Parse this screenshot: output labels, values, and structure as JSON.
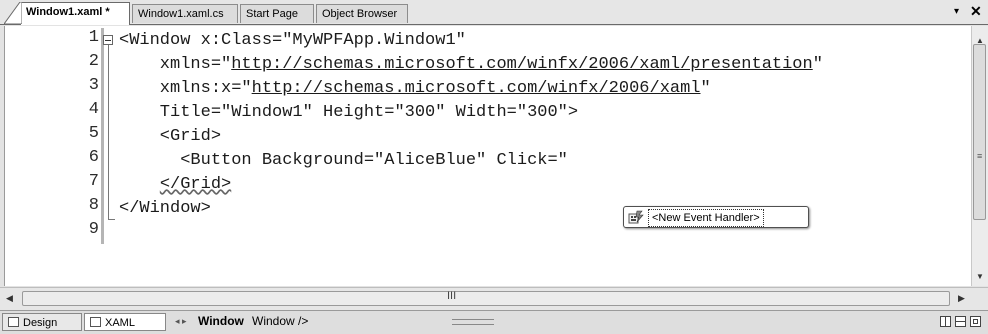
{
  "tabs": [
    {
      "label": "Window1.xaml *",
      "active": true
    },
    {
      "label": "Window1.xaml.cs",
      "active": false
    },
    {
      "label": "Start Page",
      "active": false
    },
    {
      "label": "Object Browser",
      "active": false
    }
  ],
  "tab_controls": {
    "dropdown": "▾",
    "close": "✕"
  },
  "editor": {
    "line_numbers": [
      "1",
      "2",
      "3",
      "4",
      "5",
      "6",
      "7",
      "8",
      "9"
    ],
    "lines": [
      {
        "pre": "<Window x:Class=\"MyWPFApp.Window1\"",
        "url": "",
        "post": ""
      },
      {
        "pre": "    xmlns=\"",
        "url": "http://schemas.microsoft.com/winfx/2006/xaml/presentation",
        "post": "\""
      },
      {
        "pre": "    xmlns:x=\"",
        "url": "http://schemas.microsoft.com/winfx/2006/xaml",
        "post": "\""
      },
      {
        "pre": "    Title=\"Window1\" Height=\"300\" Width=\"300\">",
        "url": "",
        "post": ""
      },
      {
        "pre": "    <Grid>",
        "url": "",
        "post": ""
      },
      {
        "pre": "      <Button Background=\"AliceBlue\" Click=\"",
        "url": "",
        "post": ""
      },
      {
        "pre": "    ",
        "url": "",
        "post": "",
        "squiggle": "</Grid>"
      },
      {
        "pre": "</Window>",
        "url": "",
        "post": ""
      },
      {
        "pre": "",
        "url": "",
        "post": ""
      }
    ]
  },
  "intellisense": {
    "item": "<New Event Handler>",
    "icon": "event-handler-icon"
  },
  "scroll": {
    "hscroll_grip": "III",
    "vscroll_grip": "≡"
  },
  "bottombar": {
    "design_tab": "Design",
    "xaml_tab": "XAML",
    "crumb_arrows": "◂ ▸",
    "crumb_element": "Window",
    "crumb_tag": "Window />"
  }
}
